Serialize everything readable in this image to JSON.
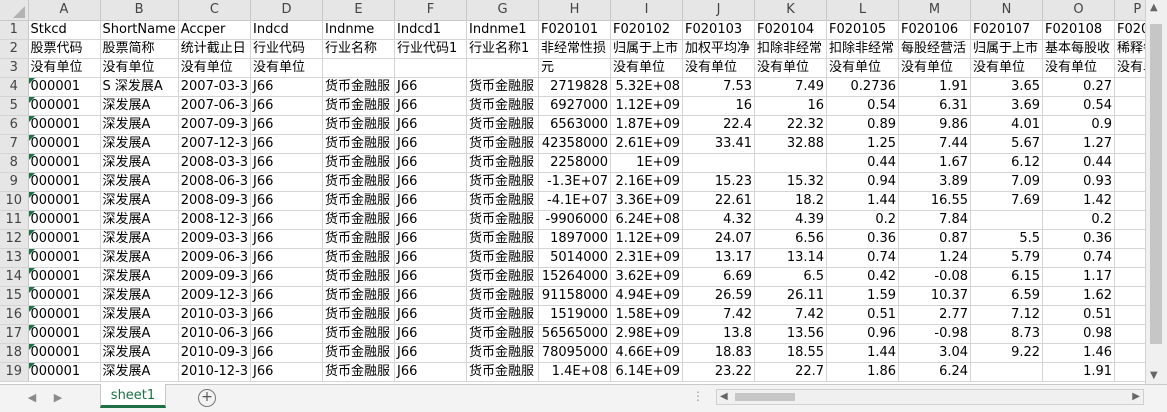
{
  "columns": [
    "A",
    "B",
    "C",
    "D",
    "E",
    "F",
    "G",
    "H",
    "I",
    "J",
    "K",
    "L",
    "M",
    "N",
    "O",
    "P"
  ],
  "row_numbers": [
    "1",
    "2",
    "3",
    "4",
    "5",
    "6",
    "7",
    "8",
    "9",
    "10",
    "11",
    "12",
    "13",
    "14",
    "15",
    "16",
    "17",
    "18",
    "19"
  ],
  "rows": [
    [
      "Stkcd",
      "ShortName",
      "Accper",
      "Indcd",
      "Indnme",
      "Indcd1",
      "Indnme1",
      "F020101",
      "F020102",
      "F020103",
      "F020104",
      "F020105",
      "F020106",
      "F020107",
      "F020108",
      "F0201"
    ],
    [
      "股票代码",
      "股票简称",
      "统计截止日",
      "行业代码",
      "行业名称",
      "行业代码1",
      "行业名称1",
      "非经常性损",
      "归属于上市",
      "加权平均净",
      "扣除非经常",
      "扣除非经常",
      "每股经营活",
      "归属于上市",
      "基本每股收",
      "稀释每"
    ],
    [
      "没有单位",
      "没有单位",
      "没有单位",
      "没有单位",
      "",
      "",
      "",
      "元",
      "没有单位",
      "没有单位",
      "没有单位",
      "没有单位",
      "没有单位",
      "没有单位",
      "没有单位",
      "没有单"
    ],
    [
      "000001",
      "S 深发展A",
      "2007-03-3",
      "J66",
      "货币金融服",
      "J66",
      "货币金融服",
      "2719828",
      "5.32E+08",
      "7.53",
      "7.49",
      "0.2736",
      "1.91",
      "3.65",
      "0.27",
      ""
    ],
    [
      "000001",
      "深发展A",
      "2007-06-3",
      "J66",
      "货币金融服",
      "J66",
      "货币金融服",
      "6927000",
      "1.12E+09",
      "16",
      "16",
      "0.54",
      "6.31",
      "3.69",
      "0.54",
      ""
    ],
    [
      "000001",
      "深发展A",
      "2007-09-3",
      "J66",
      "货币金融服",
      "J66",
      "货币金融服",
      "6563000",
      "1.87E+09",
      "22.4",
      "22.32",
      "0.89",
      "9.86",
      "4.01",
      "0.9",
      ""
    ],
    [
      "000001",
      "深发展A",
      "2007-12-3",
      "J66",
      "货币金融服",
      "J66",
      "货币金融服",
      "42358000",
      "2.61E+09",
      "33.41",
      "32.88",
      "1.25",
      "7.44",
      "5.67",
      "1.27",
      ""
    ],
    [
      "000001",
      "深发展A",
      "2008-03-3",
      "J66",
      "货币金融服",
      "J66",
      "货币金融服",
      "2258000",
      "1E+09",
      "",
      "",
      "0.44",
      "1.67",
      "6.12",
      "0.44",
      ""
    ],
    [
      "000001",
      "深发展A",
      "2008-06-3",
      "J66",
      "货币金融服",
      "J66",
      "货币金融服",
      "-1.3E+07",
      "2.16E+09",
      "15.23",
      "15.32",
      "0.94",
      "3.89",
      "7.09",
      "0.93",
      ""
    ],
    [
      "000001",
      "深发展A",
      "2008-09-3",
      "J66",
      "货币金融服",
      "J66",
      "货币金融服",
      "-4.1E+07",
      "3.36E+09",
      "22.61",
      "18.2",
      "1.44",
      "16.55",
      "7.69",
      "1.42",
      ""
    ],
    [
      "000001",
      "深发展A",
      "2008-12-3",
      "J66",
      "货币金融服",
      "J66",
      "货币金融服",
      "-9906000",
      "6.24E+08",
      "4.32",
      "4.39",
      "0.2",
      "7.84",
      "",
      "0.2",
      ""
    ],
    [
      "000001",
      "深发展A",
      "2009-03-3",
      "J66",
      "货币金融服",
      "J66",
      "货币金融服",
      "1897000",
      "1.12E+09",
      "24.07",
      "6.56",
      "0.36",
      "0.87",
      "5.5",
      "0.36",
      ""
    ],
    [
      "000001",
      "深发展A",
      "2009-06-3",
      "J66",
      "货币金融服",
      "J66",
      "货币金融服",
      "5014000",
      "2.31E+09",
      "13.17",
      "13.14",
      "0.74",
      "1.24",
      "5.79",
      "0.74",
      ""
    ],
    [
      "000001",
      "深发展A",
      "2009-09-3",
      "J66",
      "货币金融服",
      "J66",
      "货币金融服",
      "15264000",
      "3.62E+09",
      "6.69",
      "6.5",
      "0.42",
      "-0.08",
      "6.15",
      "1.17",
      ""
    ],
    [
      "000001",
      "深发展A",
      "2009-12-3",
      "J66",
      "货币金融服",
      "J66",
      "货币金融服",
      "91158000",
      "4.94E+09",
      "26.59",
      "26.11",
      "1.59",
      "10.37",
      "6.59",
      "1.62",
      ""
    ],
    [
      "000001",
      "深发展A",
      "2010-03-3",
      "J66",
      "货币金融服",
      "J66",
      "货币金融服",
      "1519000",
      "1.58E+09",
      "7.42",
      "7.42",
      "0.51",
      "2.77",
      "7.12",
      "0.51",
      ""
    ],
    [
      "000001",
      "深发展A",
      "2010-06-3",
      "J66",
      "货币金融服",
      "J66",
      "货币金融服",
      "56565000",
      "2.98E+09",
      "13.8",
      "13.56",
      "0.96",
      "-0.98",
      "8.73",
      "0.98",
      ""
    ],
    [
      "000001",
      "深发展A",
      "2010-09-3",
      "J66",
      "货币金融服",
      "J66",
      "货币金融服",
      "78095000",
      "4.66E+09",
      "18.83",
      "18.55",
      "1.44",
      "3.04",
      "9.22",
      "1.46",
      ""
    ],
    [
      "000001",
      "深发展A",
      "2010-12-3",
      "J66",
      "货币金融服",
      "J66",
      "货币金融服",
      "1.4E+08",
      "6.14E+09",
      "23.22",
      "22.7",
      "1.86",
      "6.24",
      "",
      "1.91",
      ""
    ]
  ],
  "sheet_tab": "sheet1",
  "add_sheet_symbol": "+",
  "nav_prev": "◀",
  "nav_next": "▶",
  "colors": {
    "accent": "#1e7145",
    "header_bg": "#e6e6e6",
    "gridline": "#d4d4d4"
  }
}
